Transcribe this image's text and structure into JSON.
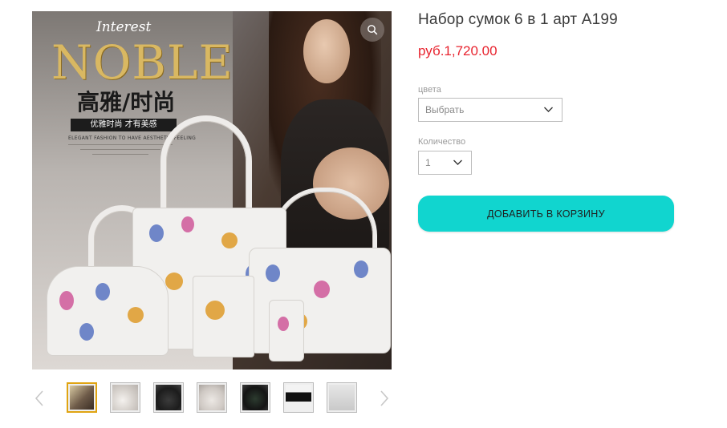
{
  "product": {
    "title": "Набор сумок 6 в 1 арт A199",
    "price": "руб.1,720.00"
  },
  "image": {
    "brand_small": "Interest",
    "brand_big": "NOBLE",
    "brand_cn": "高雅/时尚",
    "brand_tag": "优雅时尚 才有美感",
    "brand_sub": "ELEGANT FASHION TO HAVE AESTHETIC FEELING",
    "zoom_icon": "magnifier-icon"
  },
  "options": {
    "color_label": "цвета",
    "color_value": "Выбрать",
    "quantity_label": "Количество",
    "quantity_value": "1"
  },
  "cart": {
    "add_label": "ДОБАВИТЬ В КОРЗИНУ"
  },
  "thumbnails": {
    "count": 7,
    "selected_index": 0,
    "prev_icon": "chevron-left-icon",
    "next_icon": "chevron-right-icon"
  },
  "colors": {
    "accent_button": "#11d5cf",
    "price": "#e8242f",
    "thumb_active_border": "#e0a412"
  }
}
